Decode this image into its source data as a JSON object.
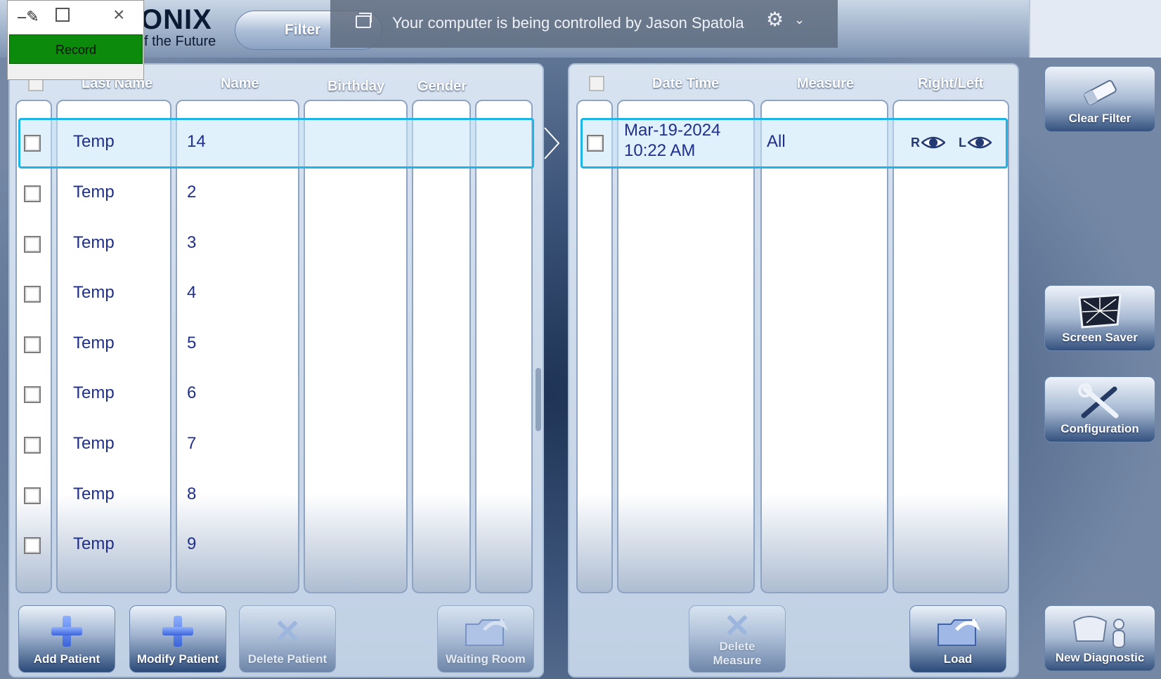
{
  "app": {
    "logo": "ONIX",
    "slogan": "f the Future",
    "filter_label": "Filter"
  },
  "banner": {
    "text": "Your computer is being controlled by Jason Spatola"
  },
  "recorder": {
    "record_label": "Record"
  },
  "patients": {
    "headers": {
      "last_name": "Last Name",
      "name": "Name",
      "birthday": "Birthday",
      "gender": "Gender"
    },
    "rows": [
      {
        "last": "Temp",
        "name": "14"
      },
      {
        "last": "Temp",
        "name": "2"
      },
      {
        "last": "Temp",
        "name": "3"
      },
      {
        "last": "Temp",
        "name": "4"
      },
      {
        "last": "Temp",
        "name": "5"
      },
      {
        "last": "Temp",
        "name": "6"
      },
      {
        "last": "Temp",
        "name": "7"
      },
      {
        "last": "Temp",
        "name": "8"
      },
      {
        "last": "Temp",
        "name": "9"
      }
    ]
  },
  "measures": {
    "headers": {
      "date_time": "Date Time",
      "measure": "Measure",
      "right_left": "Right/Left"
    },
    "rows": [
      {
        "date": "Mar-19-2024",
        "time": "10:22 AM",
        "measure": "All",
        "r": "R",
        "l": "L"
      }
    ]
  },
  "buttons": {
    "add_patient": "Add Patient",
    "modify_patient": "Modify Patient",
    "delete_patient": "Delete Patient",
    "waiting_room": "Waiting Room",
    "delete_measure_1": "Delete",
    "delete_measure_2": "Measure",
    "load": "Load"
  },
  "side": {
    "clear_filter": "Clear Filter",
    "screen_saver": "Screen Saver",
    "configuration": "Configuration",
    "new_diagnostic": "New Diagnostic"
  }
}
